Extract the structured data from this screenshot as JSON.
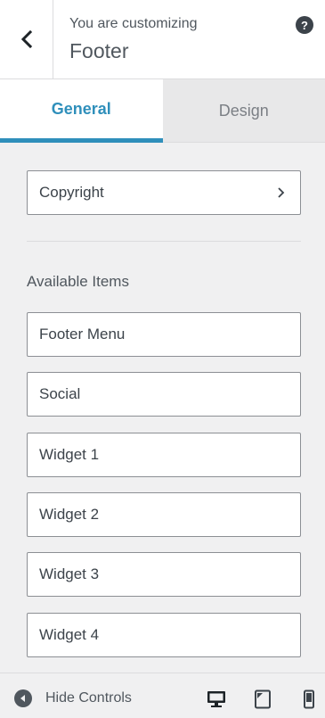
{
  "header": {
    "subtitle": "You are customizing",
    "title": "Footer"
  },
  "tabs": [
    {
      "label": "General",
      "active": true
    },
    {
      "label": "Design",
      "active": false
    }
  ],
  "content": {
    "copyright_item": "Copyright",
    "section_label": "Available Items",
    "available_items": [
      "Footer Menu",
      "Social",
      "Widget 1",
      "Widget 2",
      "Widget 3",
      "Widget 4"
    ]
  },
  "footer_bar": {
    "hide_controls_label": "Hide Controls"
  },
  "colors": {
    "accent": "#2f8fbb",
    "panel_bg": "#f0f0f1",
    "text": "#3c434a"
  },
  "icons": [
    "back-arrow-icon",
    "help-icon",
    "chevron-right-icon",
    "collapse-icon",
    "desktop-icon",
    "tablet-icon",
    "mobile-icon"
  ]
}
